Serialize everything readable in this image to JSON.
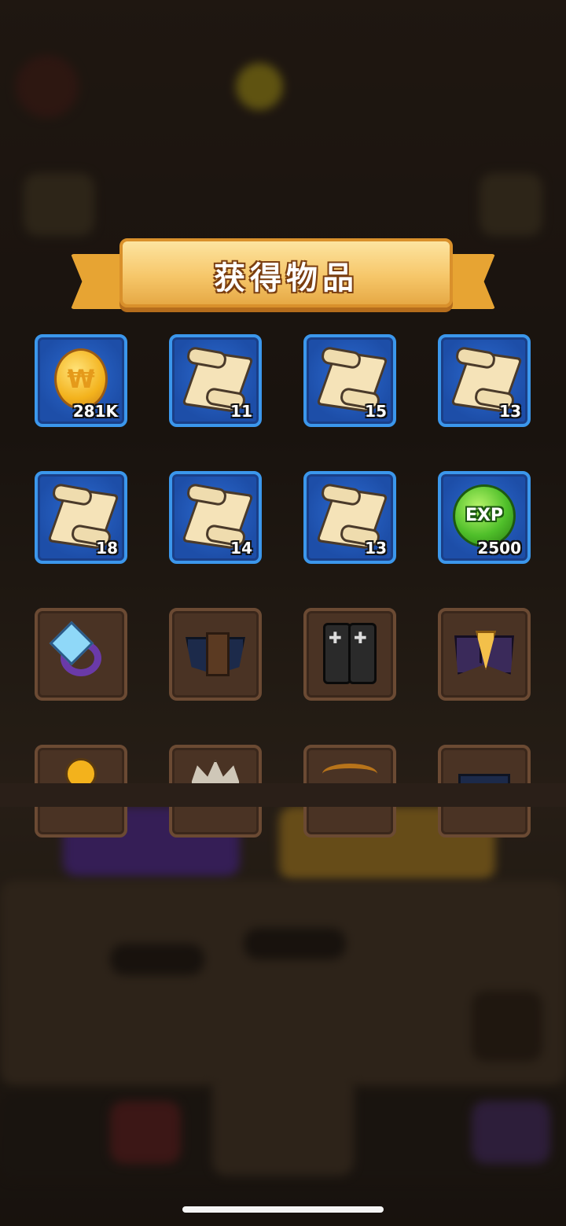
{
  "popup": {
    "title": "获得物品"
  },
  "rewards": [
    {
      "name": "coin",
      "count": "281K",
      "icon": "coin-icon"
    },
    {
      "name": "scroll",
      "count": "11",
      "icon": "scroll-icon"
    },
    {
      "name": "scroll",
      "count": "15",
      "icon": "scroll-icon"
    },
    {
      "name": "scroll",
      "count": "13",
      "icon": "scroll-icon"
    },
    {
      "name": "scroll",
      "count": "18",
      "icon": "scroll-icon"
    },
    {
      "name": "scroll",
      "count": "14",
      "icon": "scroll-icon"
    },
    {
      "name": "scroll",
      "count": "13",
      "icon": "scroll-icon"
    },
    {
      "name": "exp",
      "count": "2500",
      "icon": "exp-orb-icon",
      "label": "EXP"
    }
  ],
  "equipment": [
    {
      "icon": "ring-icon"
    },
    {
      "icon": "armor-icon"
    },
    {
      "icon": "boots-icon"
    },
    {
      "icon": "cape-icon"
    }
  ],
  "colors": {
    "slot_blue": "#1d4ea8",
    "slot_blue_border": "#3b97ec",
    "slot_brown": "#4a3324",
    "banner": "#f6c76a"
  }
}
